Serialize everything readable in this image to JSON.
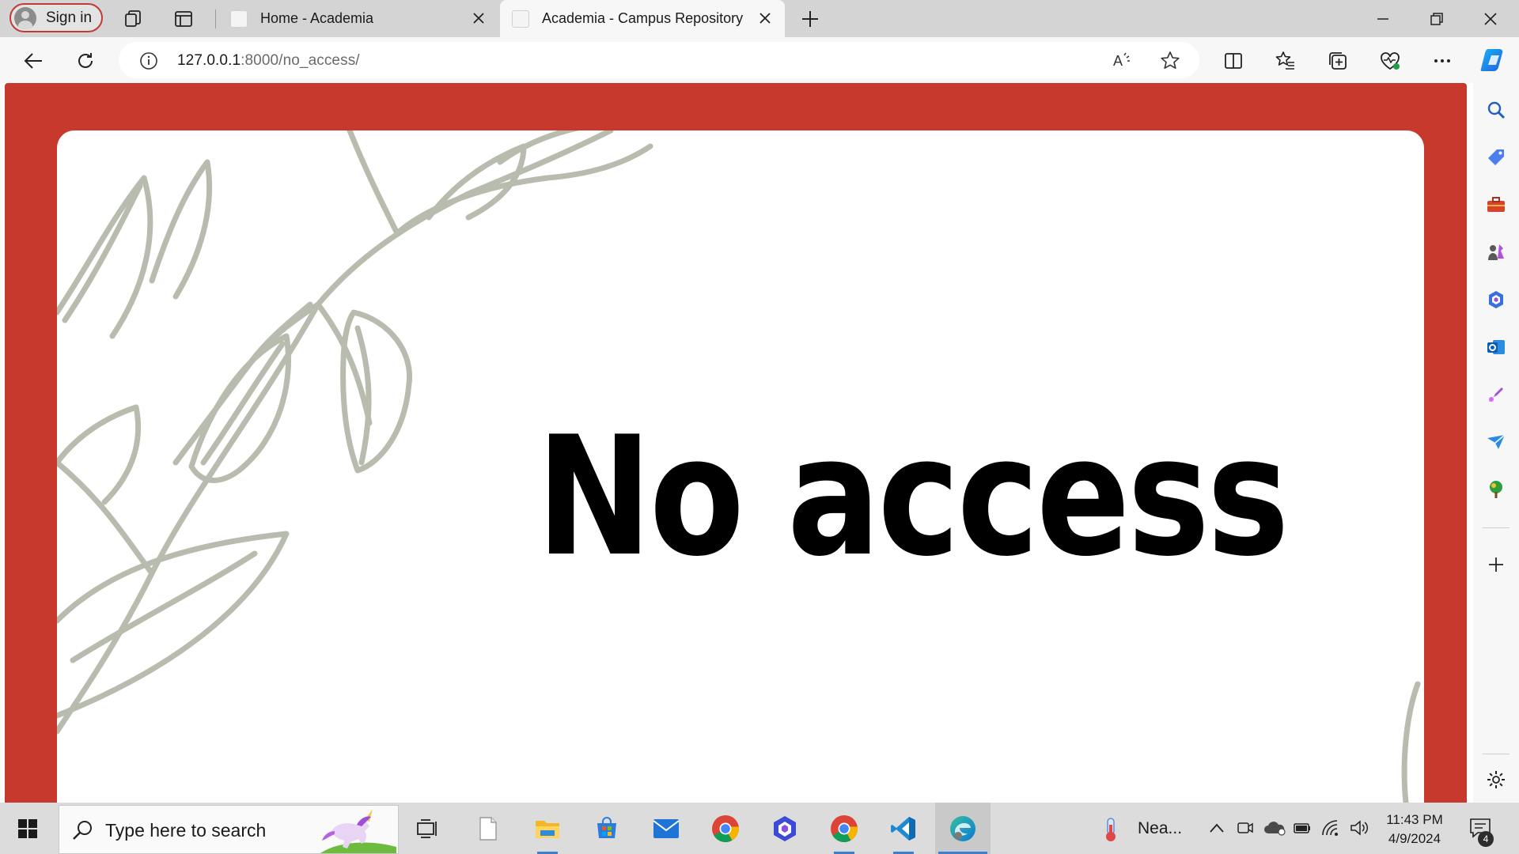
{
  "browser": {
    "sign_in_label": "Sign in",
    "tabs": [
      {
        "title": "Home - Academia",
        "active": false
      },
      {
        "title": "Academia - Campus Repository",
        "active": true
      }
    ],
    "address": {
      "host": "127.0.0.1",
      "path": ":8000/no_access/"
    }
  },
  "page": {
    "heading": "No access",
    "frame_color": "#c6392c",
    "leaf_color": "#b8bcae"
  },
  "sidebar": {
    "icons": [
      "search-icon",
      "shopping-tag-icon",
      "toolbox-icon",
      "games-icon",
      "microsoft-365-icon",
      "outlook-icon",
      "designer-icon",
      "send-icon",
      "tree-icon",
      "add-icon",
      "settings-icon"
    ]
  },
  "taskbar": {
    "search_placeholder": "Type here to search",
    "apps": [
      "task-view-icon",
      "notepad-icon",
      "file-explorer-icon",
      "microsoft-store-icon",
      "mail-icon",
      "chrome-icon",
      "copilot-app-icon",
      "chrome-profile-icon",
      "vscode-icon",
      "edge-icon"
    ],
    "weather": "Nea...",
    "time": "11:43 PM",
    "date": "4/9/2024",
    "notification_count": "4"
  }
}
